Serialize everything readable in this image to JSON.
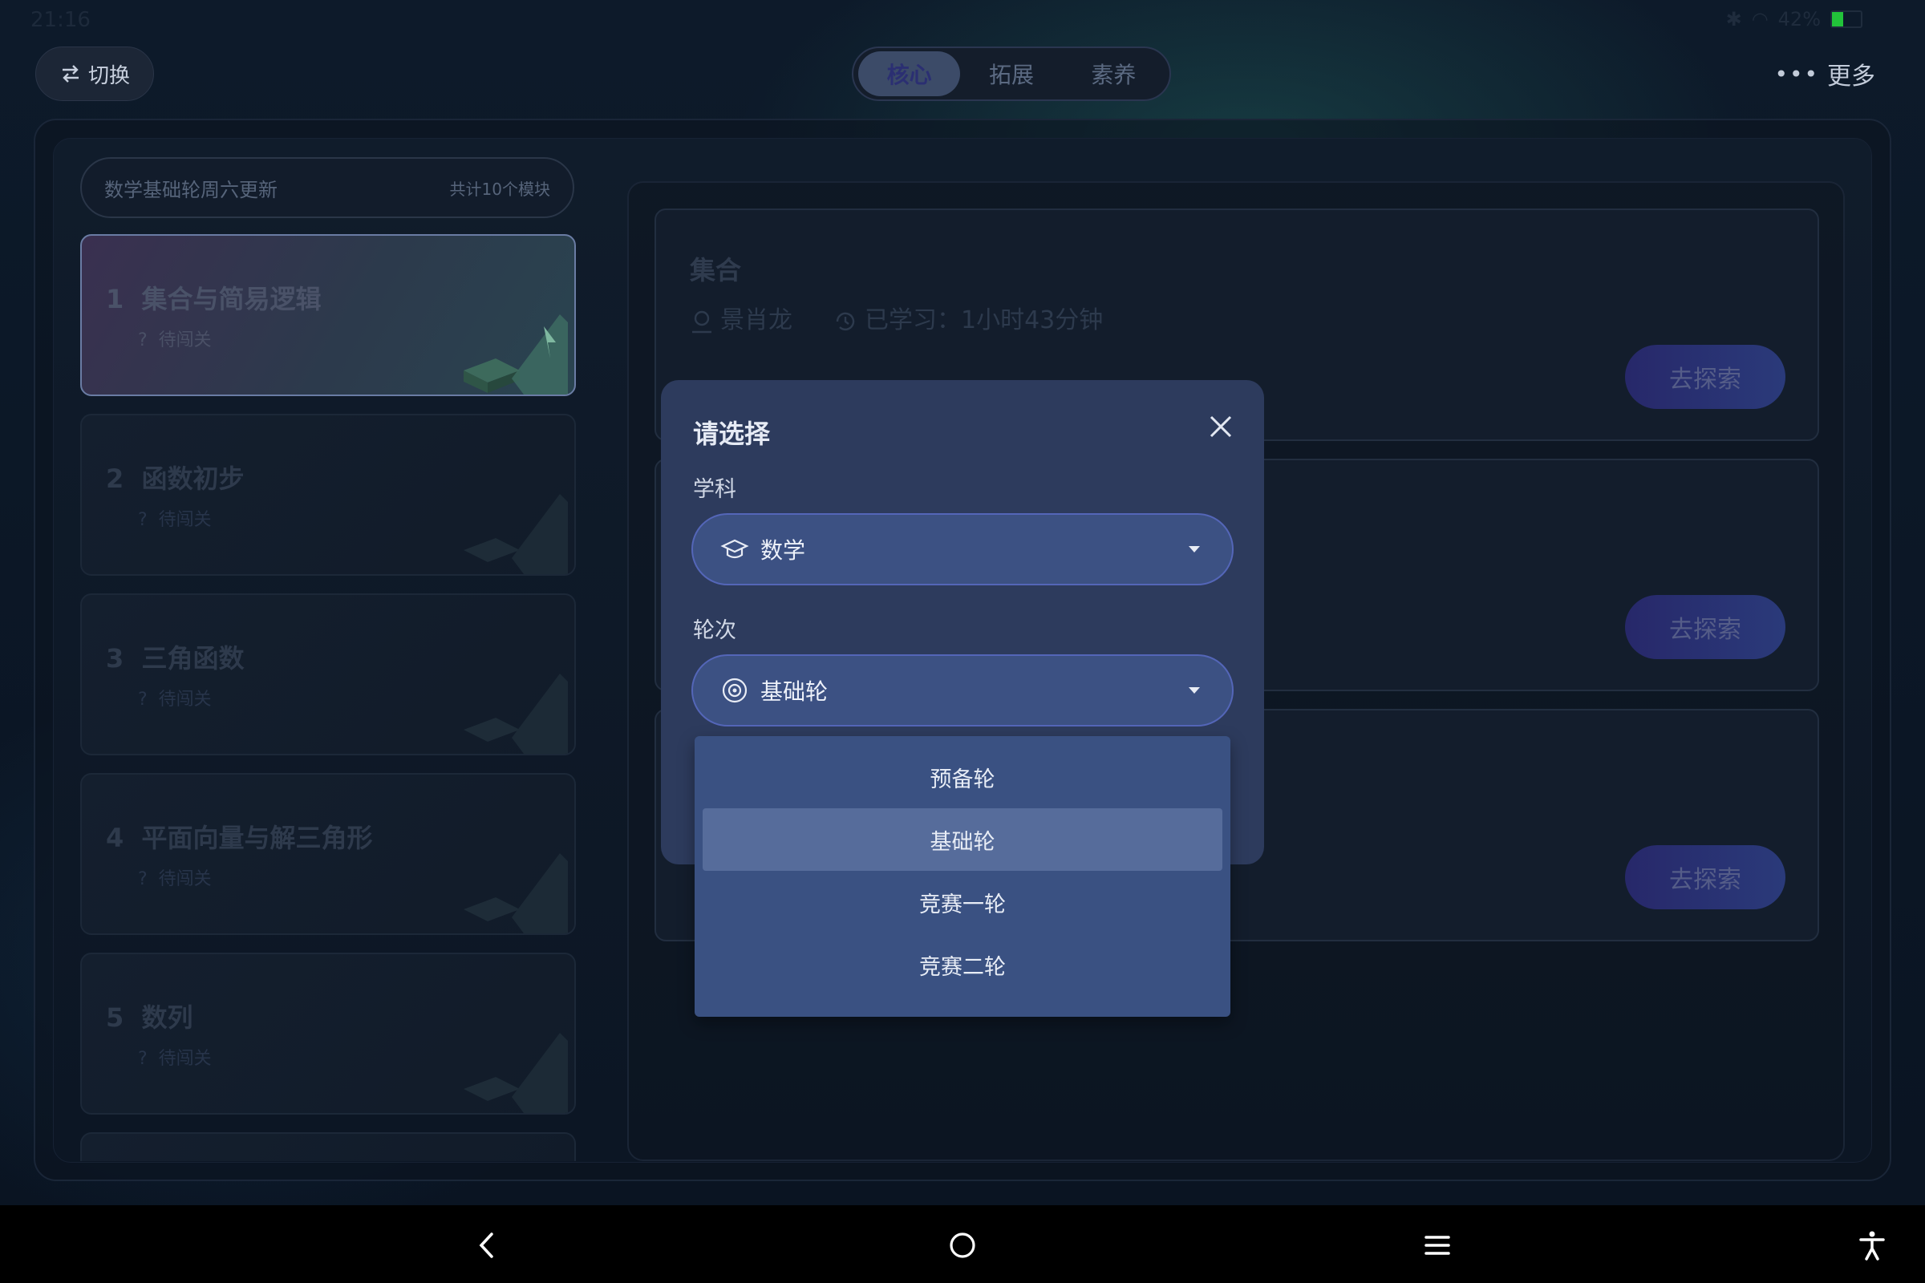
{
  "status_bar": {
    "time": "21:16",
    "battery": "42%"
  },
  "header": {
    "switch_label": "切换",
    "tabs": [
      {
        "label": "核心",
        "active": true
      },
      {
        "label": "拓展",
        "active": false
      },
      {
        "label": "素养",
        "active": false
      }
    ],
    "more_label": "更多"
  },
  "sidebar": {
    "chapter_title": "数学基础轮周六更新",
    "module_count": "共计10个模块",
    "modules": [
      {
        "num": "1",
        "name": "集合与简易逻辑",
        "status": "待闯关",
        "active": true
      },
      {
        "num": "2",
        "name": "函数初步",
        "status": "待闯关",
        "active": false
      },
      {
        "num": "3",
        "name": "三角函数",
        "status": "待闯关",
        "active": false
      },
      {
        "num": "4",
        "name": "平面向量与解三角形",
        "status": "待闯关",
        "active": false
      },
      {
        "num": "5",
        "name": "数列",
        "status": "待闯关",
        "active": false
      }
    ]
  },
  "courses": [
    {
      "title": "集合",
      "teacher": "景肖龙",
      "studied_label": "已学习：1小时43分钟",
      "button": "去探索"
    },
    {
      "title": "",
      "teacher": "",
      "studied_label": "",
      "button": "去探索"
    },
    {
      "title": "",
      "teacher": "",
      "studied_label": "",
      "button": "去探索"
    }
  ],
  "modal": {
    "title": "请选择",
    "subject_label": "学科",
    "subject_value": "数学",
    "round_label": "轮次",
    "round_value": "基础轮",
    "round_options": [
      "预备轮",
      "基础轮",
      "竞赛一轮",
      "竞赛二轮"
    ],
    "selected_option": "基础轮"
  },
  "icons": {
    "switch": "swap-arrows-icon",
    "more": "more-dots-icon",
    "close": "close-icon",
    "subject": "graduation-cap-icon",
    "round": "target-icon",
    "nav_back": "back-chevron-icon",
    "nav_home": "home-circle-icon",
    "nav_menu": "menu-lines-icon",
    "nav_accessibility": "accessibility-icon"
  },
  "colors": {
    "modal_bg": "#2d3b5d",
    "select_bg": "#3c5183",
    "select_border": "#5466b8",
    "explore_button": "#27286a",
    "battery": "#22c33a"
  }
}
